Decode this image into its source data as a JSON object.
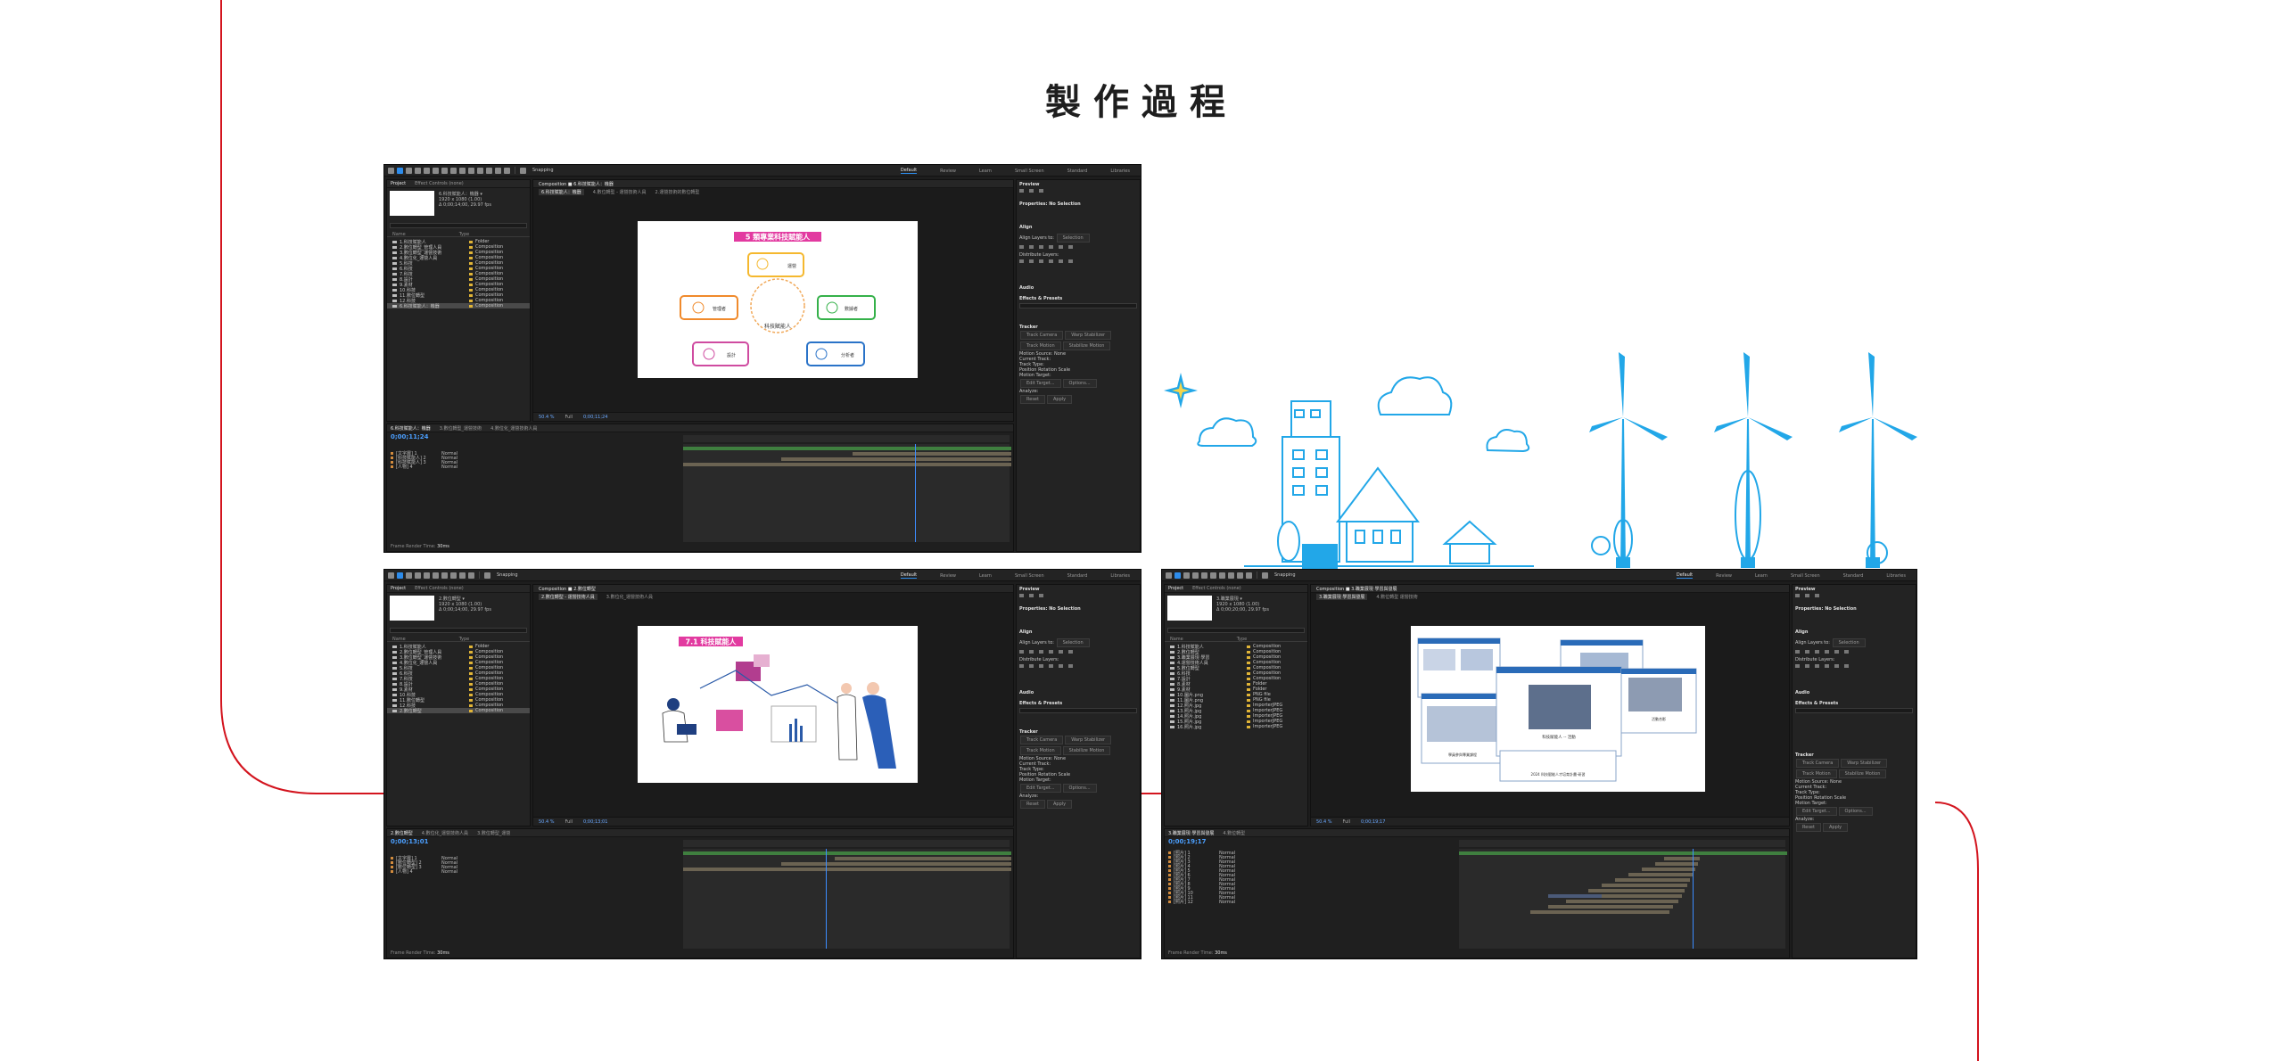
{
  "page": {
    "title": "製作過程"
  },
  "ae": {
    "toolbar": {
      "snapping_label": "Snapping"
    },
    "workspace_tabs": [
      "Default",
      "Review",
      "Learn",
      "Small Screen",
      "Standard",
      "Libraries"
    ],
    "project_tabs": [
      "Project",
      "Effect Controls (none)"
    ],
    "preview": {
      "title": "Preview"
    },
    "properties_title": "Properties: No Selection",
    "align": {
      "title": "Align",
      "align_layers_to": "Align Layers to:",
      "selection": "Selection",
      "distribute": "Distribute Layers:"
    },
    "audio_title": "Audio",
    "effects_title": "Effects & Presets",
    "tracker": {
      "title": "Tracker",
      "buttons": [
        "Track Camera",
        "Warp Stabilizer",
        "Track Motion",
        "Stabilize Motion"
      ],
      "motion_source": "Motion Source:",
      "motion_source_val": "None",
      "current_track": "Current Track:",
      "track_type": "Track Type:",
      "options": [
        "Position",
        "Rotation",
        "Scale"
      ],
      "motion_target": "Motion Target:",
      "edit_target": "Edit Target...",
      "options_btn": "Options...",
      "analyze": "Analyze:",
      "reset": "Reset",
      "apply": "Apply"
    },
    "comp_footer": {
      "zoom": "50.4 %",
      "res": "Full"
    },
    "timeline": {
      "footer_label": "Frame Render Time:",
      "footer_value": "30ms"
    }
  },
  "windows": [
    {
      "comp_tab": "Composition ■ 6.科技賦能人：機器",
      "crumbs": [
        "6.科技賦能人：機器",
        "4.數位轉型 - 運營技術人員",
        "2.運營技術的數位轉型"
      ],
      "project_thumb_info": [
        "6.科技賦能人：機器 ▾",
        "1920 x 1080 (1.00)",
        "Δ 0;00;14;00, 29.97 fps"
      ],
      "project_rows": [
        "1.科技賦能人",
        "2.數位轉型_管理人員",
        "3.數位轉型_運營技術",
        "4.數位化_運營人員",
        "5.科技",
        "6.科技",
        "7.科技",
        "8.設計",
        "9.素材",
        "10.科技",
        "11.數位轉型",
        "12.科技",
        "13.科技",
        "14.科技",
        "15.科技",
        "6.科技賦能人：機器"
      ],
      "timeline_tabs": [
        "6.科技賦能人：機器",
        "3.數位轉型_運營技術",
        "4.數位化_運營技術人員"
      ],
      "time": "0;00;11;24",
      "layers": [
        "[文字層] 1",
        "[科技賦能人] 2",
        "[科技賦能人] 3",
        "[人物] 4"
      ],
      "footer_time": "0;00;11;24"
    },
    {
      "comp_tab": "Composition ■ 2.數位轉型",
      "crumbs": [
        "2.數位轉型 - 運營技術人員",
        "3.數位化_運營技術人員"
      ],
      "project_thumb_info": [
        "2.數位轉型 ▾",
        "1920 x 1080 (1.00)",
        "Δ 0;00;14;00, 29.97 fps"
      ],
      "project_rows": [
        "1.科技賦能人",
        "2.數位轉型_管理人員",
        "3.數位轉型_運營技術",
        "4.數位化_運營人員",
        "5.科技",
        "6.科技",
        "7.科技",
        "8.設計",
        "9.素材",
        "10.科技",
        "11.數位轉型",
        "12.科技",
        "13.科技",
        "14.科技",
        "15.科技",
        "2.數位轉型"
      ],
      "timeline_tabs": [
        "2.數位轉型",
        "4.數位化_運營技術人員",
        "3.數位轉型_運營"
      ],
      "time": "0;00;13;01",
      "layers": [
        "[文字層] 1",
        "[數位轉型] 2",
        "[數位轉型] 3",
        "[人物] 4"
      ],
      "footer_time": "0;00;13;01"
    },
    {
      "comp_tab": "Composition ■ 3.職業展現 學習與發展",
      "crumbs": [
        "3.職業展現 學習與發展",
        "4.數位轉型 運營技術"
      ],
      "project_thumb_info": [
        "3.職業展現 ▾",
        "1920 x 1080 (1.00)",
        "Δ 0;00;20;00, 29.97 fps"
      ],
      "project_rows": [
        "1.科技賦能人",
        "2.數位轉型",
        "3.職業展現 學習",
        "4.運營技術人員",
        "5.數位轉型",
        "6.科技",
        "7.設計",
        "8.素材",
        "9.素材",
        "10.圖片.png",
        "11.圖片.png",
        "12.照片.jpg",
        "13.照片.jpg",
        "14.照片.jpg",
        "15.照片.jpg",
        "16.照片.jpg"
      ],
      "timeline_tabs": [
        "3.職業展現 學習與發展",
        "4.數位轉型"
      ],
      "time": "0;00;19;17",
      "layers": [
        "[照片] 1",
        "[照片] 2",
        "[照片] 3",
        "[照片] 4",
        "[照片] 5",
        "[照片] 6",
        "[照片] 7",
        "[照片] 8",
        "[照片] 9",
        "[照片] 10",
        "[照片] 11",
        "[照片] 12"
      ],
      "footer_time": "0;00;19;17"
    }
  ],
  "slides": {
    "slide1": {
      "title": "5 類專業科技賦能人",
      "center": "科技賦能人",
      "nodes": [
        "運營",
        "管理者",
        "數據者",
        "設計",
        "分析者"
      ]
    },
    "slide2": {
      "title": "7.1 科技賦能人"
    },
    "slide3": {
      "center_caption": "科技賦能人 -- 活動",
      "bottom_caption": "2024 科技賦能人才培育計畫-研習",
      "left_caption": "學員參與專業課程",
      "right_caption": "活動合影"
    }
  },
  "colors": {
    "accent_red": "#d3141e",
    "sky_blue": "#22a7e8",
    "ae_blue": "#2d8ceb",
    "slide_pink": "#e23aa0"
  }
}
